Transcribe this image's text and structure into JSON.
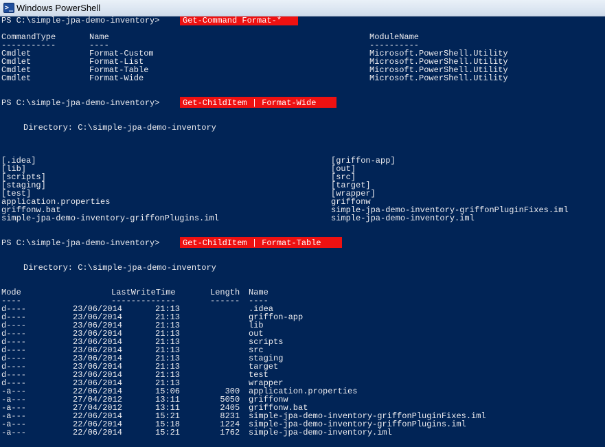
{
  "window": {
    "title": "Windows PowerShell",
    "icon": "powershell-icon",
    "icon_glyph": ">_"
  },
  "colors": {
    "console_background": "#012456",
    "console_foreground": "#eeedf0",
    "command_highlight": "#ee1111"
  },
  "prompt": "PS C:\\simple-jpa-demo-inventory>",
  "commands": [
    {
      "text": "Get-Command Format-*"
    },
    {
      "text": "Get-ChildItem | Format-Wide"
    },
    {
      "text": "Get-ChildItem | Format-Table"
    }
  ],
  "get_command": {
    "headers": {
      "type": "CommandType",
      "name": "Name",
      "module": "ModuleName"
    },
    "underlines": {
      "type": "-----------",
      "name": "----",
      "module": "----------"
    },
    "rows": [
      {
        "type": "Cmdlet",
        "name": "Format-Custom",
        "module": "Microsoft.PowerShell.Utility"
      },
      {
        "type": "Cmdlet",
        "name": "Format-List",
        "module": "Microsoft.PowerShell.Utility"
      },
      {
        "type": "Cmdlet",
        "name": "Format-Table",
        "module": "Microsoft.PowerShell.Utility"
      },
      {
        "type": "Cmdlet",
        "name": "Format-Wide",
        "module": "Microsoft.PowerShell.Utility"
      }
    ]
  },
  "format_wide": {
    "directory_line": "Directory: C:\\simple-jpa-demo-inventory",
    "rows": [
      {
        "left": "[.idea]",
        "right": "[griffon-app]"
      },
      {
        "left": "[lib]",
        "right": "[out]"
      },
      {
        "left": "[scripts]",
        "right": "[src]"
      },
      {
        "left": "[staging]",
        "right": "[target]"
      },
      {
        "left": "[test]",
        "right": "[wrapper]"
      },
      {
        "left": "application.properties",
        "right": "griffonw"
      },
      {
        "left": "griffonw.bat",
        "right": "simple-jpa-demo-inventory-griffonPluginFixes.iml"
      },
      {
        "left": "simple-jpa-demo-inventory-griffonPlugins.iml",
        "right": "simple-jpa-demo-inventory.iml"
      }
    ]
  },
  "format_table": {
    "directory_line": "Directory: C:\\simple-jpa-demo-inventory",
    "headers": {
      "mode": "Mode",
      "lastwrite": "LastWriteTime",
      "length": "Length",
      "name": "Name"
    },
    "underlines": {
      "mode": "----",
      "lastwrite": "-------------",
      "length": "------",
      "name": "----"
    },
    "rows": [
      {
        "mode": "d----",
        "date": "23/06/2014",
        "time": "21:13",
        "length": "",
        "name": ".idea"
      },
      {
        "mode": "d----",
        "date": "23/06/2014",
        "time": "21:13",
        "length": "",
        "name": "griffon-app"
      },
      {
        "mode": "d----",
        "date": "23/06/2014",
        "time": "21:13",
        "length": "",
        "name": "lib"
      },
      {
        "mode": "d----",
        "date": "23/06/2014",
        "time": "21:13",
        "length": "",
        "name": "out"
      },
      {
        "mode": "d----",
        "date": "23/06/2014",
        "time": "21:13",
        "length": "",
        "name": "scripts"
      },
      {
        "mode": "d----",
        "date": "23/06/2014",
        "time": "21:13",
        "length": "",
        "name": "src"
      },
      {
        "mode": "d----",
        "date": "23/06/2014",
        "time": "21:13",
        "length": "",
        "name": "staging"
      },
      {
        "mode": "d----",
        "date": "23/06/2014",
        "time": "21:13",
        "length": "",
        "name": "target"
      },
      {
        "mode": "d----",
        "date": "23/06/2014",
        "time": "21:13",
        "length": "",
        "name": "test"
      },
      {
        "mode": "d----",
        "date": "23/06/2014",
        "time": "21:13",
        "length": "",
        "name": "wrapper"
      },
      {
        "mode": "-a---",
        "date": "22/06/2014",
        "time": "15:06",
        "length": "300",
        "name": "application.properties"
      },
      {
        "mode": "-a---",
        "date": "27/04/2012",
        "time": "13:11",
        "length": "5050",
        "name": "griffonw"
      },
      {
        "mode": "-a---",
        "date": "27/04/2012",
        "time": "13:11",
        "length": "2405",
        "name": "griffonw.bat"
      },
      {
        "mode": "-a---",
        "date": "22/06/2014",
        "time": "15:21",
        "length": "8231",
        "name": "simple-jpa-demo-inventory-griffonPluginFixes.iml"
      },
      {
        "mode": "-a---",
        "date": "22/06/2014",
        "time": "15:18",
        "length": "1224",
        "name": "simple-jpa-demo-inventory-griffonPlugins.iml"
      },
      {
        "mode": "-a---",
        "date": "22/06/2014",
        "time": "15:21",
        "length": "1762",
        "name": "simple-jpa-demo-inventory.iml"
      }
    ]
  }
}
